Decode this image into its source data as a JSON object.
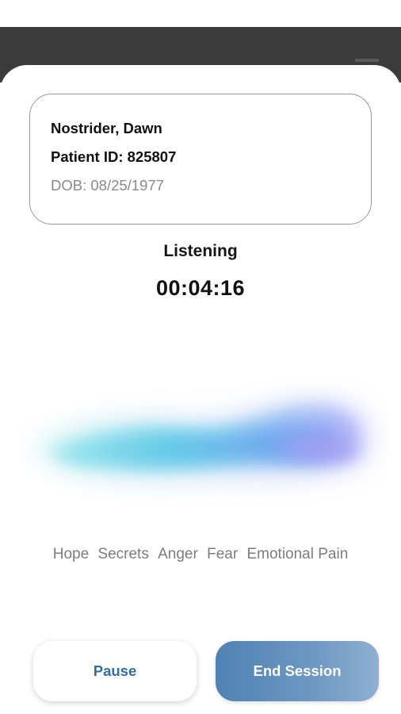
{
  "app_bar": {
    "background_color": "#3b3b3b"
  },
  "patient": {
    "name": "Nostrider, Dawn",
    "id_label": "Patient ID:",
    "id_value": "825807",
    "dob_label": "DOB:",
    "dob_value": "08/25/1977"
  },
  "session": {
    "status": "Listening",
    "timer": "00:04:16"
  },
  "emotions": [
    "Hope",
    "Secrets",
    "Anger",
    "Fear",
    "Emotional Pain"
  ],
  "buttons": {
    "pause_label": "Pause",
    "end_label": "End Session"
  },
  "colors": {
    "primary": "#2f6fa6",
    "end_button_start": "#4f82b4",
    "end_button_end": "#8fb0d2",
    "muted_text": "#7d7d7d"
  },
  "icons": {
    "back": "back-arrow-icon",
    "menu": "hamburger-menu-icon",
    "wave": "audio-wave-visualizer"
  }
}
